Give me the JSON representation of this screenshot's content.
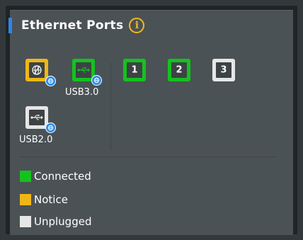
{
  "panel": {
    "title": "Ethernet Ports",
    "info_glyph": "i"
  },
  "ports": {
    "wan": {
      "status": "notice",
      "icon": "wan-globe-icon",
      "badge_icon": "globe-icon"
    },
    "usb3": {
      "status": "connected",
      "icon": "usb-icon",
      "badge_icon": "globe-icon",
      "label": "USB3.0"
    },
    "lan": [
      {
        "number": "1",
        "status": "connected"
      },
      {
        "number": "2",
        "status": "connected"
      },
      {
        "number": "3",
        "status": "unplugged"
      }
    ],
    "usb2": {
      "status": "unplugged",
      "icon": "usb-icon",
      "badge_icon": "globe-icon",
      "label": "USB2.0"
    }
  },
  "legend": [
    {
      "label": "Connected",
      "color": "#14c21e"
    },
    {
      "label": "Notice",
      "color": "#f0b617"
    },
    {
      "label": "Unplugged",
      "color": "#e6e6e6"
    }
  ],
  "colors": {
    "accent": "#2f86e8",
    "info": "#f5b81e",
    "connected": "#14c21e",
    "notice": "#f0b617",
    "unplugged": "#e6e6e6"
  }
}
